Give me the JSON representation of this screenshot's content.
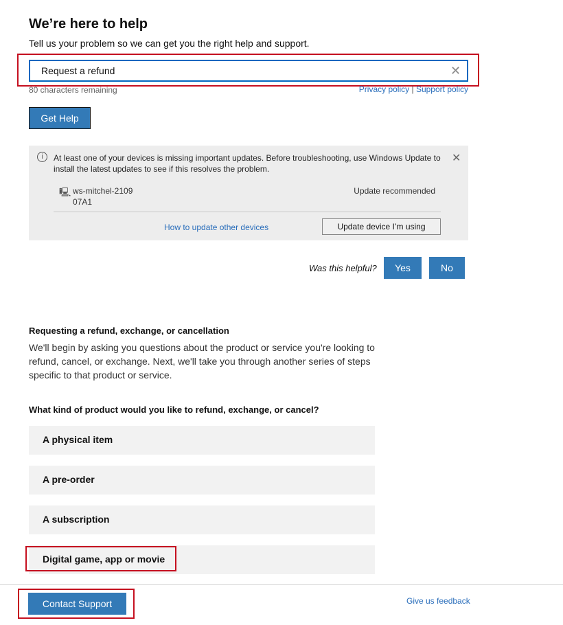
{
  "header": {
    "title": "We’re here to help",
    "subtitle": "Tell us your problem so we can get you the right help and support."
  },
  "search": {
    "value": "Request a refund",
    "chars_remaining": "80 characters remaining",
    "privacy": "Privacy policy",
    "separator": "|",
    "support_policy": "Support policy"
  },
  "get_help": "Get Help",
  "notice": {
    "text": "At least one of your devices is missing important updates. Before troubleshooting, use Windows Update to install the latest updates to see if this resolves the problem.",
    "device_name": "ws-mitchel-2109",
    "device_id": "07A1",
    "status": "Update recommended",
    "other_link": "How to update other devices",
    "update_button": "Update device I’m using"
  },
  "helpful": {
    "question": "Was this helpful?",
    "yes": "Yes",
    "no": "No"
  },
  "refund": {
    "title": "Requesting a refund, exchange, or cancellation",
    "body": "We'll begin by asking you questions about the product or service you're looking to refund, cancel, or exchange. Next, we'll take you through another series of steps specific to that product or service.",
    "question": "What kind of product would you like to refund, exchange, or cancel?",
    "options": [
      "A physical item",
      "A pre-order",
      "A subscription",
      "Digital game, app or movie"
    ]
  },
  "footer": {
    "contact": "Contact Support",
    "feedback": "Give us feedback"
  },
  "colors": {
    "accent": "#337ab7",
    "highlight": "#c50f1f"
  }
}
